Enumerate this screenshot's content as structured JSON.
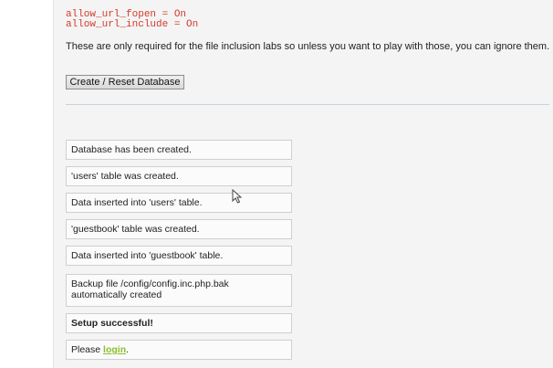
{
  "config_lines": [
    "allow_url_fopen = On",
    "allow_url_include = On"
  ],
  "note": "These are only required for the file inclusion labs so unless you want to play with those, you can ignore them.",
  "create_button_label": "Create / Reset Database",
  "messages": [
    "Database has been created.",
    "'users' table was created.",
    "Data inserted into 'users' table.",
    "'guestbook' table was created.",
    "Data inserted into 'guestbook' table.",
    "Backup file /config/config.inc.php.bak automatically created",
    "Setup successful!"
  ],
  "login_prefix": "Please ",
  "login_link": "login",
  "login_suffix": ".",
  "colors": {
    "code": "#d23a2a",
    "link": "#8bbf2d"
  }
}
